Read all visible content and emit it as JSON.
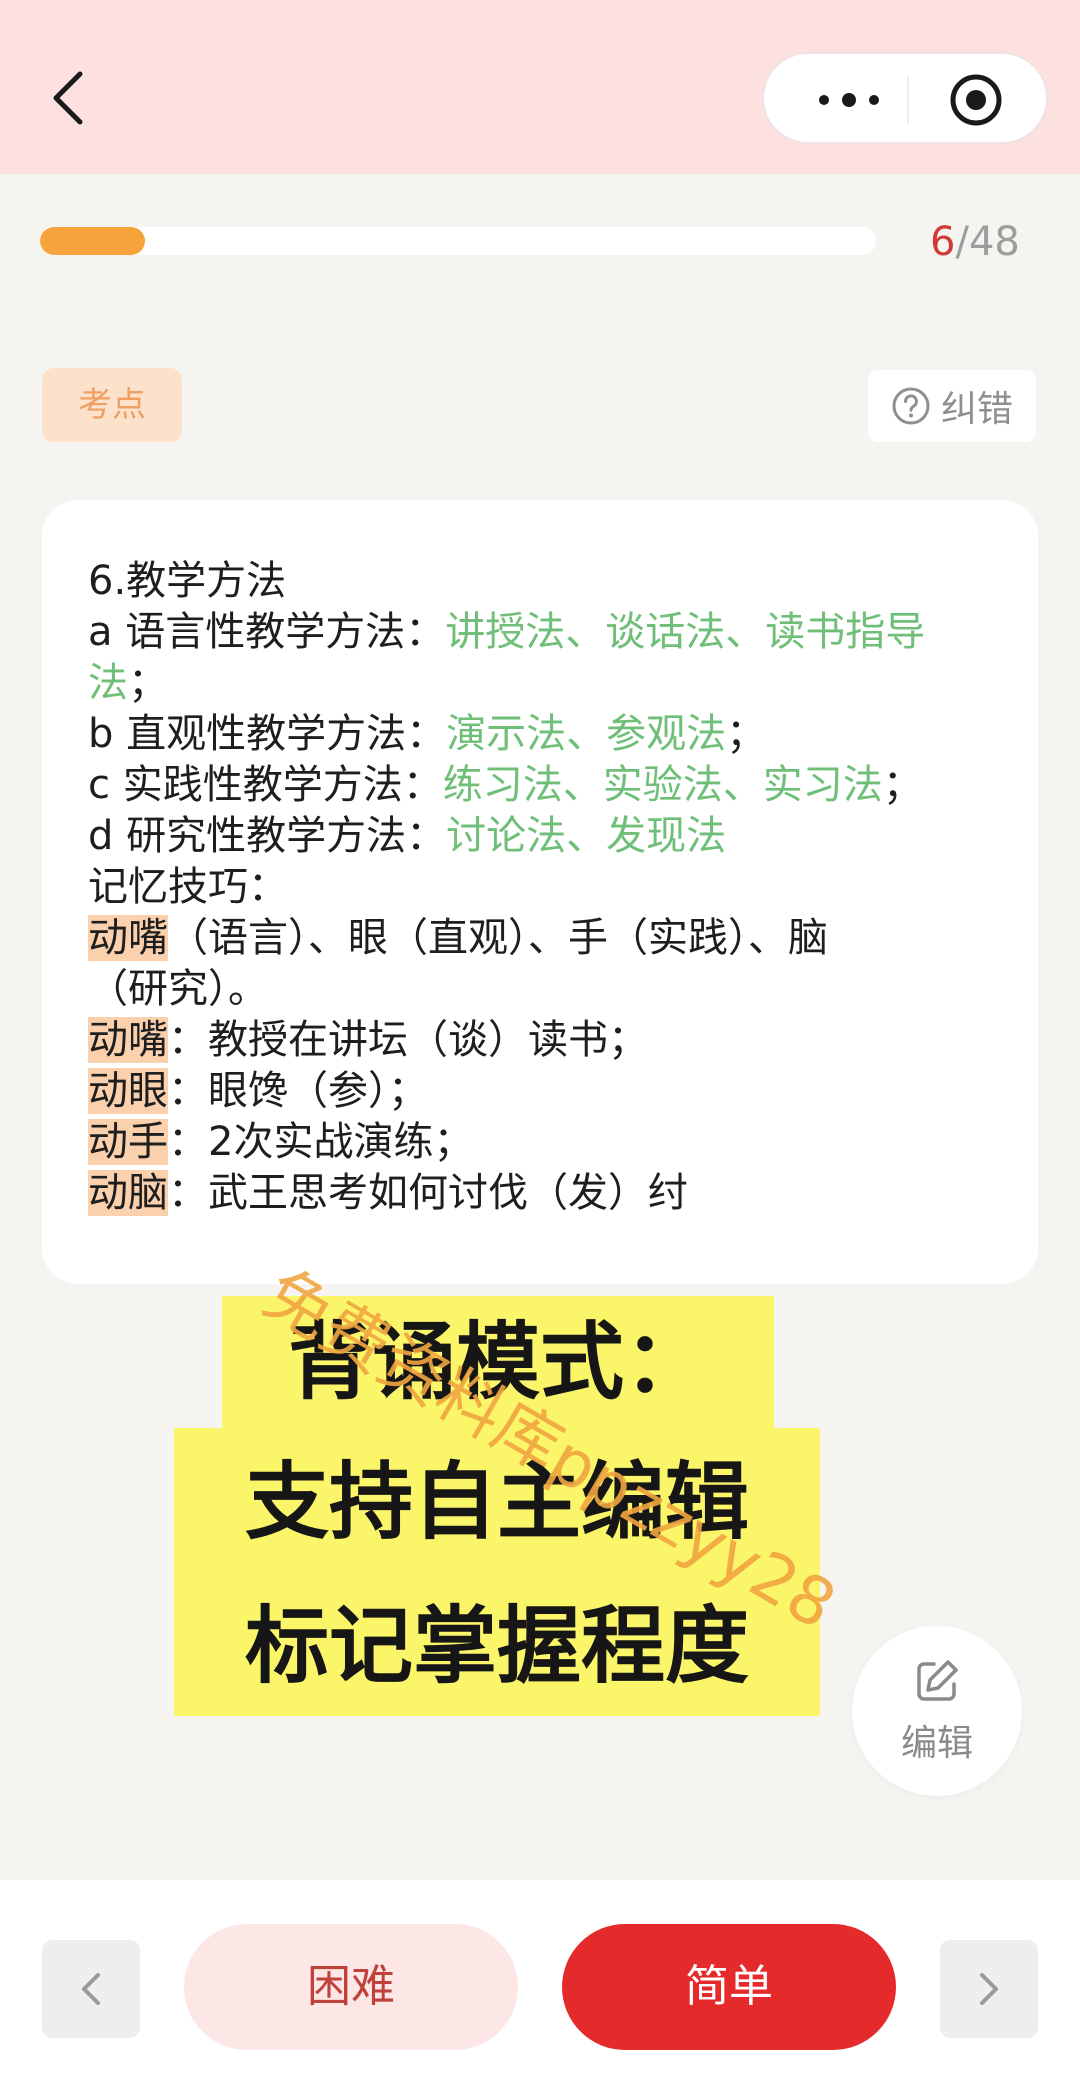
{
  "header": {
    "back_icon": "chevron-left-icon",
    "more_icon": "more-dots-icon",
    "target_icon": "target-icon"
  },
  "progress": {
    "current": "6",
    "separator": "/",
    "total": "48",
    "fraction": 0.125,
    "accent": "#f6a33c"
  },
  "tag_label": "考点",
  "correct": {
    "icon": "question-circle-icon",
    "label": "纠错"
  },
  "card": {
    "title": "6.教学方法",
    "a_label": "a 语言性教学方法：",
    "a_methods_1": "讲授法、谈话法、读书指导",
    "a_methods_2": "法",
    "a_end": "；",
    "b_label": "b 直观性教学方法：",
    "b_methods": "演示法、参观法",
    "b_end": "；",
    "c_label": "c 实践性教学方法：",
    "c_methods": "练习法、实验法、实习法",
    "c_end": "；",
    "d_label": "d 研究性教学方法：",
    "d_methods": "讨论法、发现法",
    "tip_title": "记忆技巧：",
    "tip_hl": "动嘴",
    "tip_line_1": "（语言）、眼（直观）、手（实践）、脑",
    "tip_line_2": "（研究）。",
    "m1_hl": "动嘴",
    "m1_text": "：教授在讲坛（谈）读书；",
    "m2_hl": "动眼",
    "m2_text": "：眼馋（参）；",
    "m3_hl": "动手",
    "m3_text": "：2次实战演练；",
    "m4_hl": "动脑",
    "m4_text": "：武王思考如何讨伐（发）纣"
  },
  "promo": {
    "line1": "背诵模式：",
    "line2": "支持自主编辑",
    "line3": "标记掌握程度"
  },
  "watermark": "免费资料库ppzzyy28",
  "edit": {
    "icon": "edit-icon",
    "label": "编辑"
  },
  "footer": {
    "prev_icon": "chevron-left-icon",
    "next_icon": "chevron-right-icon",
    "hard_label": "困难",
    "easy_label": "简单",
    "easy_color": "#e42a2a"
  }
}
